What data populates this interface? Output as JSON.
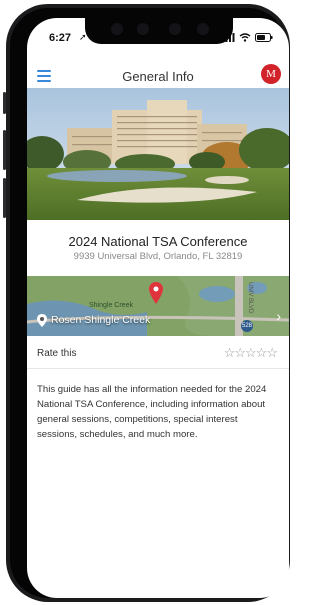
{
  "status": {
    "time": "6:27"
  },
  "header": {
    "title": "General Info",
    "avatar_initial": "M"
  },
  "conference": {
    "name": "2024 National TSA Conference",
    "address": "9939 Universal Blvd, Orlando, FL 32819"
  },
  "map": {
    "location_label": "Rosen Shingle Creek",
    "map_text": "Shingle Creek",
    "road_text": "UNIV BLVD",
    "road_badge": "528"
  },
  "rating": {
    "label": "Rate this",
    "stars": "☆☆☆☆☆",
    "max": 5,
    "value": 0
  },
  "description": "This guide has all the information needed for the 2024 National TSA Conference, including information about general sessions, competitions, special interest sessions, schedules, and much more.",
  "colors": {
    "accent": "#3b87d9",
    "avatar": "#d2232a",
    "pin": "#e0343c"
  }
}
